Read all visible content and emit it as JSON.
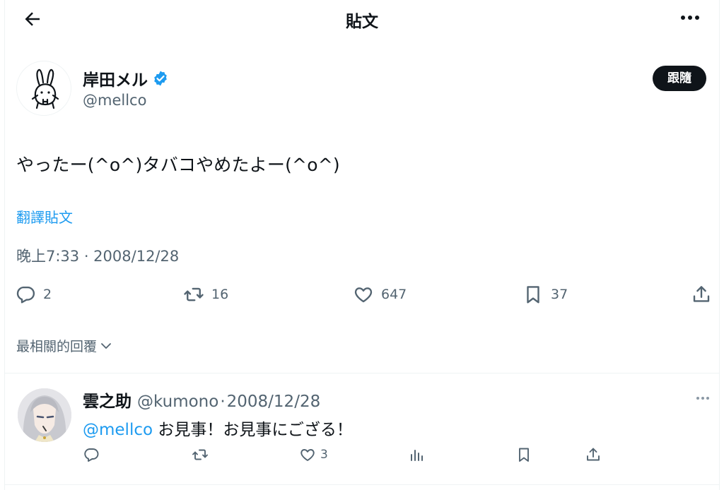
{
  "header": {
    "title": "貼文"
  },
  "tweet": {
    "author_name": "岸田メル",
    "author_handle": "@mellco",
    "follow_label": "跟隨",
    "text": "やったー(^o^)タバコやめたよー(^o^)",
    "translate_label": "翻譯貼文",
    "timestamp": "晚上7:33 · 2008/12/28",
    "stats": {
      "replies": "2",
      "reposts": "16",
      "likes": "647",
      "bookmarks": "37"
    }
  },
  "replies_sort_label": "最相關的回覆",
  "reply": {
    "name": "雲之助",
    "handle": "@kumono",
    "separator": "·",
    "date": "2008/12/28",
    "mention": "@mellco",
    "text": " お見事！お見事にござる！",
    "likes": "3"
  },
  "colors": {
    "accent": "#1d9bf0",
    "text": "#0f1419",
    "secondary": "#536471",
    "verified": "#1d9bf0"
  }
}
